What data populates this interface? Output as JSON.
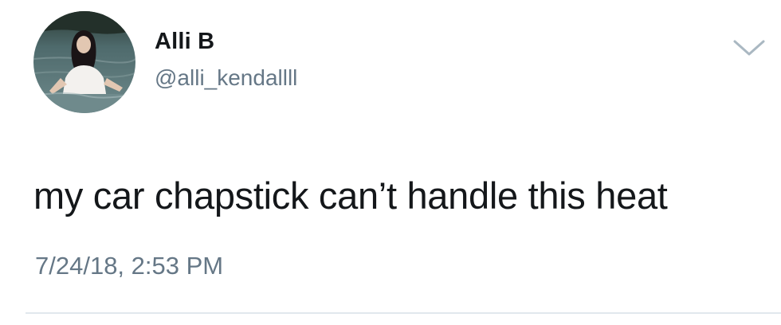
{
  "tweet": {
    "author": {
      "display_name": "Alli B",
      "handle": "@alli_kendallll"
    },
    "text": "my car chapstick can’t handle this heat",
    "timestamp": "7/24/18, 2:53 PM",
    "menu_icon": "chevron-down-icon"
  },
  "colors": {
    "text_primary": "#14171a",
    "text_secondary": "#657786",
    "divider": "#e1e8ed",
    "caret": "#aab8c2"
  }
}
